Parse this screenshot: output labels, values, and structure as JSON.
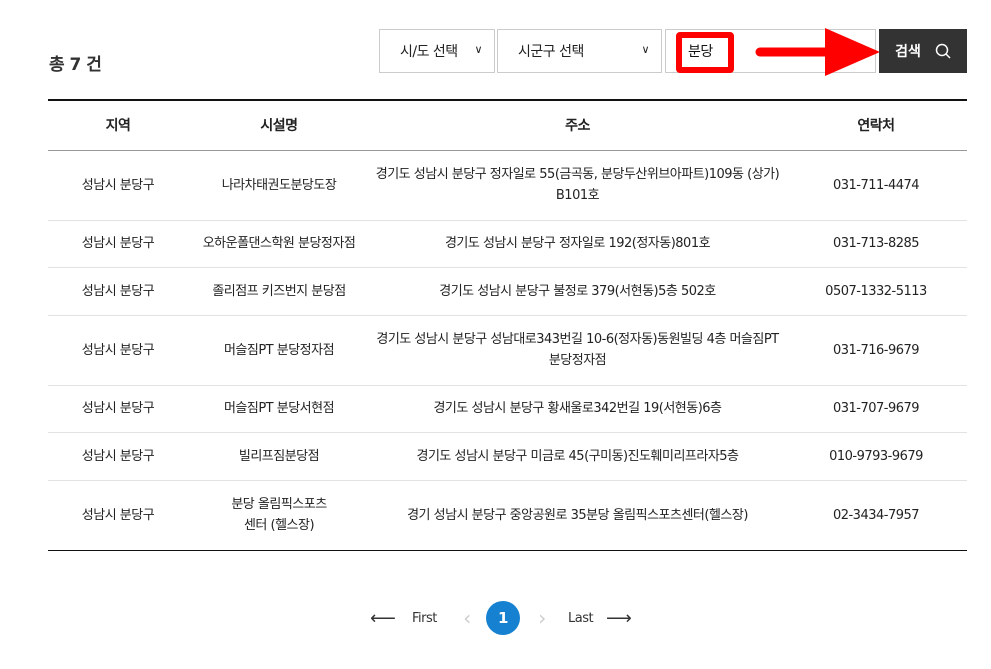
{
  "summary": {
    "total": "총 7 건"
  },
  "search": {
    "sido": "시/도 선택",
    "sigungu": "시군구 선택",
    "keyword": "분당",
    "button": "검색"
  },
  "annotation": {
    "color": "#ff0000"
  },
  "table": {
    "headers": [
      "지역",
      "시설명",
      "주소",
      "연락처"
    ],
    "rows": [
      [
        "성남시 분당구",
        "나라차태권도분당도장",
        "경기도 성남시 분당구 정자일로 55(금곡동, 분당두산위브아파트)109동 (상가) B101호",
        "031-711-4474"
      ],
      [
        "성남시 분당구",
        "오하운폴댄스학원 분당정자점",
        "경기도 성남시 분당구 정자일로 192(정자동)801호",
        "031-713-8285"
      ],
      [
        "성남시 분당구",
        "졸리점프 키즈번지 분당점",
        "경기도 성남시 분당구 불정로 379(서현동)5층 502호",
        "0507-1332-5113"
      ],
      [
        "성남시 분당구",
        "머슬짐PT 분당정자점",
        "경기도 성남시 분당구 성남대로343번길 10-6(정자동)동원빌딩 4층 머슬짐PT 분당정자점",
        "031-716-9679"
      ],
      [
        "성남시 분당구",
        "머슬짐PT 분당서현점",
        "경기도 성남시 분당구 황새울로342번길 19(서현동)6층",
        "031-707-9679"
      ],
      [
        "성남시 분당구",
        "빌리프짐분당점",
        "경기도 성남시 분당구 미금로 45(구미동)진도훼미리프라자5층",
        "010-9793-9679"
      ],
      [
        "성남시 분당구",
        "분당 올림픽스포츠센터 (헬스장)",
        "경기 성남시 분당구 중앙공원로 35분당 올림픽스포츠센터(헬스장)",
        "02-3434-7957"
      ]
    ]
  },
  "pagination": {
    "first": "First",
    "last": "Last",
    "current": "1",
    "accent": "#1581d0"
  }
}
